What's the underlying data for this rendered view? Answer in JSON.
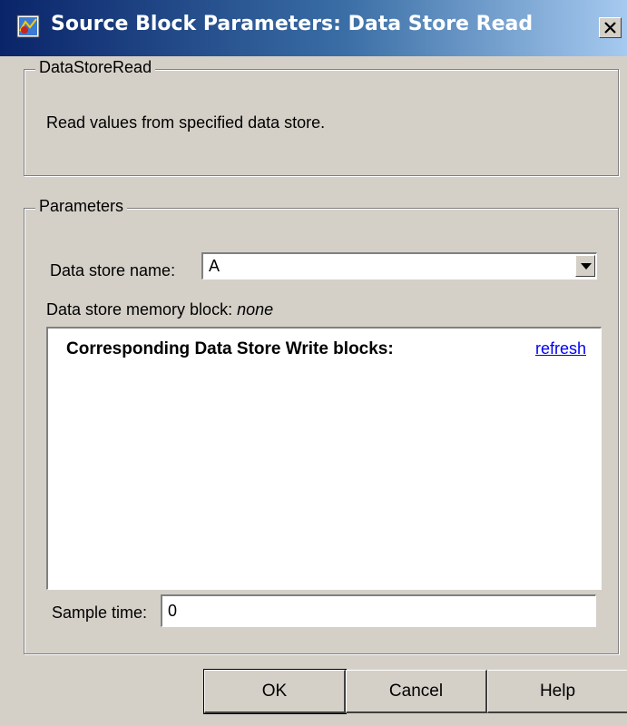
{
  "window": {
    "title": "Source Block Parameters: Data Store Read"
  },
  "description_group": {
    "legend": "DataStoreRead",
    "text": "Read values from specified data store."
  },
  "parameters_group": {
    "legend": "Parameters",
    "data_store_name": {
      "label": "Data store name:",
      "value": "A"
    },
    "memory_block": {
      "label": "Data store memory block:",
      "value": "none"
    },
    "write_blocks": {
      "heading": "Corresponding Data Store Write blocks:",
      "refresh_label": "refresh"
    },
    "sample_time": {
      "label": "Sample time:",
      "value": "0"
    }
  },
  "buttons": {
    "ok": "OK",
    "cancel": "Cancel",
    "help": "Help"
  },
  "colors": {
    "dialog_bg": "#d4d0c8",
    "titlebar_start": "#0a246a",
    "titlebar_end": "#a6caf0",
    "link": "#0000ee"
  },
  "icons": {
    "app": "simulink-block-icon",
    "close": "close-icon",
    "dropdown": "chevron-down-icon"
  }
}
